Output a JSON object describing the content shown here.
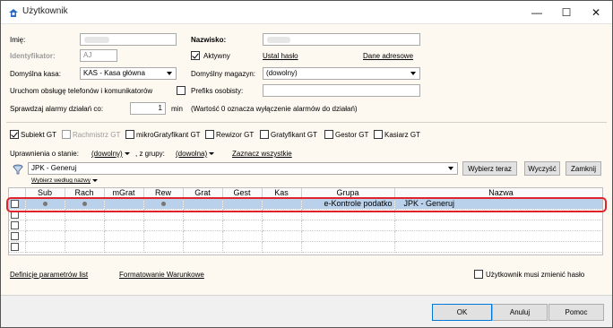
{
  "window": {
    "title": "Użytkownik",
    "icon": "user-app-icon",
    "minimize": "—",
    "maximize": "☐",
    "close": "✕"
  },
  "form": {
    "imie_label": "Imię:",
    "nazwisko_label": "Nazwisko:",
    "identyfikator_label": "Identyfikator:",
    "identyfikator_value": "AJ",
    "aktywny_label": "Aktywny",
    "aktywny_checked": true,
    "ustal_haslo": "Ustal hasło",
    "dane_adresowe": "Dane adresowe",
    "kasa_label": "Domyślna kasa:",
    "kasa_value": "KAS - Kasa główna",
    "magazyn_label": "Domyślny magazyn:",
    "magazyn_value": "(dowolny)",
    "telefony_label": "Uruchom obsługę telefonów i komunikatorów",
    "prefiks_label": "Prefiks osobisty:",
    "alarmy_label": "Sprawdzaj alarmy działań co:",
    "alarmy_value": "1",
    "alarmy_unit": "min",
    "alarmy_note": "(Wartość 0 oznacza wyłączenie alarmów do działań)"
  },
  "roles": [
    {
      "label": "Subiekt GT",
      "checked": true,
      "enabled": true
    },
    {
      "label": "Rachmistrz GT",
      "checked": false,
      "enabled": false
    },
    {
      "label": "mikroGratyfikant GT",
      "checked": false,
      "enabled": true
    },
    {
      "label": "Rewizor GT",
      "checked": false,
      "enabled": true
    },
    {
      "label": "Gratyfikant GT",
      "checked": false,
      "enabled": true
    },
    {
      "label": "Gestor GT",
      "checked": false,
      "enabled": true
    },
    {
      "label": "Kasiarz GT",
      "checked": false,
      "enabled": true
    }
  ],
  "permissions": {
    "label": "Uprawnienia o stanie:",
    "state_value": "(dowolny)",
    "group_label": ", z grupy:",
    "group_value": "(dowolna)",
    "select_all": "Zaznacz wszystkie",
    "filter_value": "JPK - Generuj",
    "btn_choose": "Wybierz teraz",
    "btn_clear": "Wyczyść",
    "btn_close": "Zamknij",
    "choose_by": "Wybierz według nazwy"
  },
  "grid": {
    "columns": [
      "Sub",
      "Rach",
      "mGrat",
      "Rew",
      "Grat",
      "Gest",
      "Kas",
      "Grupa",
      "Nazwa"
    ],
    "rows": [
      {
        "selected": true,
        "marks": [
          true,
          true,
          false,
          true,
          false,
          false,
          false
        ],
        "grupa": "e-Kontrole podatko",
        "nazwa": "JPK - Generuj"
      },
      {
        "selected": false,
        "marks": [
          false,
          false,
          false,
          false,
          false,
          false,
          false
        ],
        "grupa": "",
        "nazwa": ""
      },
      {
        "selected": false,
        "marks": [
          false,
          false,
          false,
          false,
          false,
          false,
          false
        ],
        "grupa": "",
        "nazwa": ""
      },
      {
        "selected": false,
        "marks": [
          false,
          false,
          false,
          false,
          false,
          false,
          false
        ],
        "grupa": "",
        "nazwa": ""
      },
      {
        "selected": false,
        "marks": [
          false,
          false,
          false,
          false,
          false,
          false,
          false
        ],
        "grupa": "",
        "nazwa": ""
      }
    ]
  },
  "bottom": {
    "definicje": "Definicje parametrów list",
    "formatowanie": "Formatowanie Warunkowe",
    "must_change_label": "Użytkownik musi zmienić hasło",
    "must_change_checked": false
  },
  "footer": {
    "ok": "OK",
    "anuluj": "Anuluj",
    "pomoc": "Pomoc"
  },
  "colors": {
    "selection": "#b9d1ea",
    "highlight": "#e0242b",
    "form_bg": "#fdf8f0",
    "accent": "#0078d7"
  }
}
